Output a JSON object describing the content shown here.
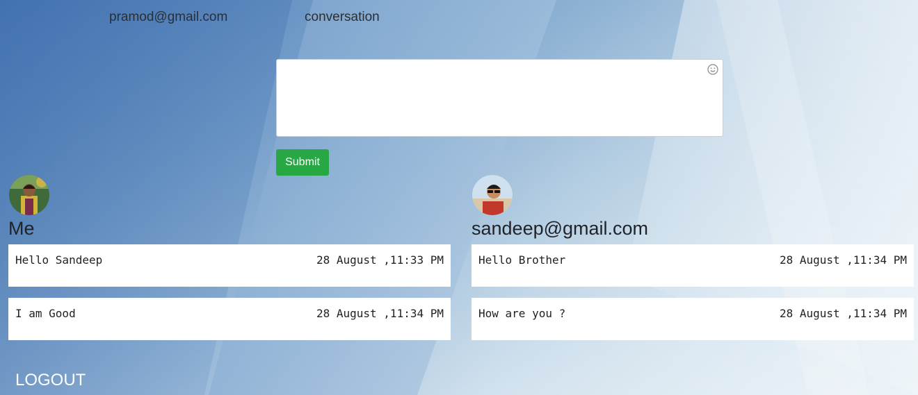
{
  "header": {
    "user_email": "pramod@gmail.com",
    "conversation_label": "conversation"
  },
  "composer": {
    "placeholder": "",
    "value": "",
    "submit_label": "Submit",
    "emoji_icon": "smiley-icon"
  },
  "me": {
    "heading": "Me",
    "messages": [
      {
        "text": "Hello Sandeep",
        "time": "28 August ,11:33 PM"
      },
      {
        "text": "I am Good",
        "time": "28 August ,11:34 PM"
      }
    ]
  },
  "other": {
    "heading": "sandeep@gmail.com",
    "messages": [
      {
        "text": "Hello Brother",
        "time": "28 August ,11:34 PM"
      },
      {
        "text": "How are you ?",
        "time": "28 August ,11:34 PM"
      }
    ]
  },
  "footer": {
    "logout_label": "LOGOUT"
  },
  "colors": {
    "submit_bg": "#28a745",
    "message_bg": "#ffffff"
  }
}
